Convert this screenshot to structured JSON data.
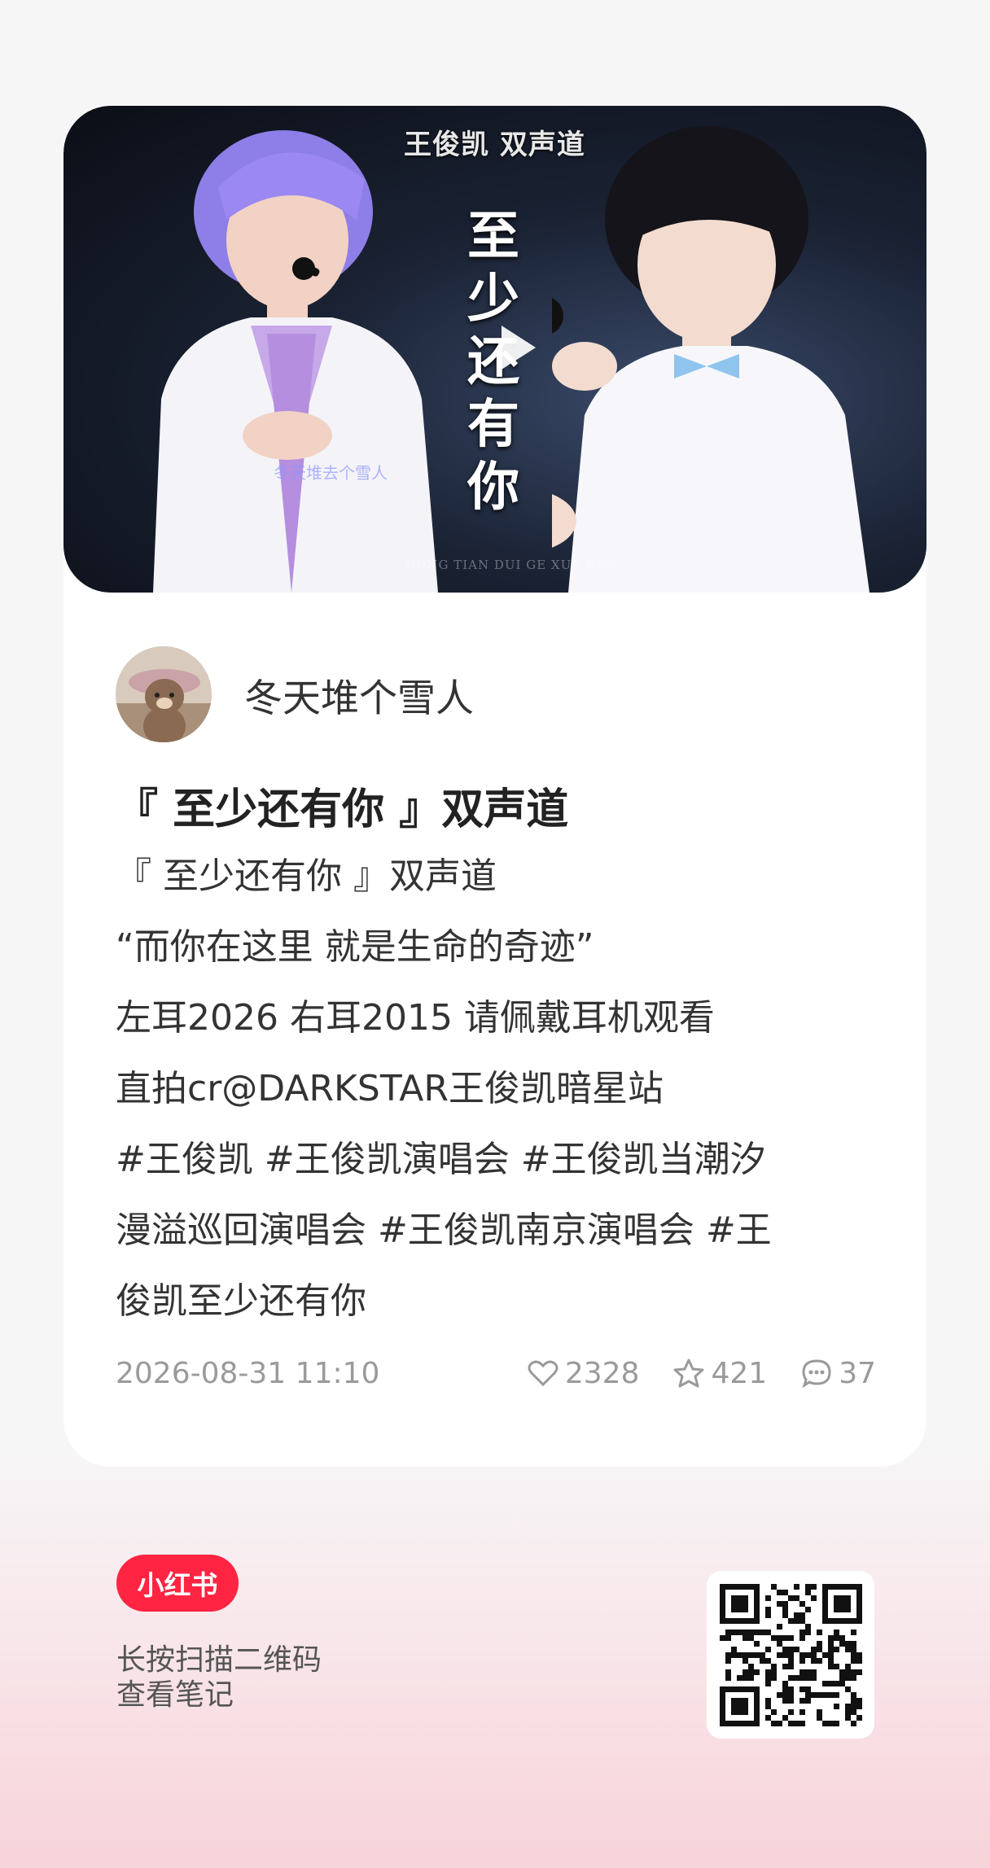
{
  "video": {
    "watermark": "王俊凯 双声道",
    "overlay_title": "至少还有你",
    "overlay_small": "DONG TIAN DUI GE XUE REN",
    "overlay_pink": "冬天堆去个雪人"
  },
  "author": {
    "name": "冬天堆个雪人"
  },
  "post": {
    "title": "『 至少还有你 』双声道",
    "lines": [
      "『 至少还有你 』双声道",
      "“而你在这里 就是生命的奇迹”",
      "左耳2026 右耳2015 请佩戴耳机观看",
      "直拍cr@DARKSTAR王俊凯暗星站",
      "#王俊凯 #王俊凯演唱会 #王俊凯当潮汐",
      "漫溢巡回演唱会 #王俊凯南京演唱会 #王",
      "俊凯至少还有你"
    ]
  },
  "meta": {
    "date": "2026-08-31 11:10",
    "likes": "2328",
    "favorites": "421",
    "comments": "37"
  },
  "footer": {
    "logo": "小红书",
    "line1": "长按扫描二维码",
    "line2": "查看笔记"
  },
  "colors": {
    "brand": "#ff2442",
    "meta_gray": "#9a9a9a"
  }
}
